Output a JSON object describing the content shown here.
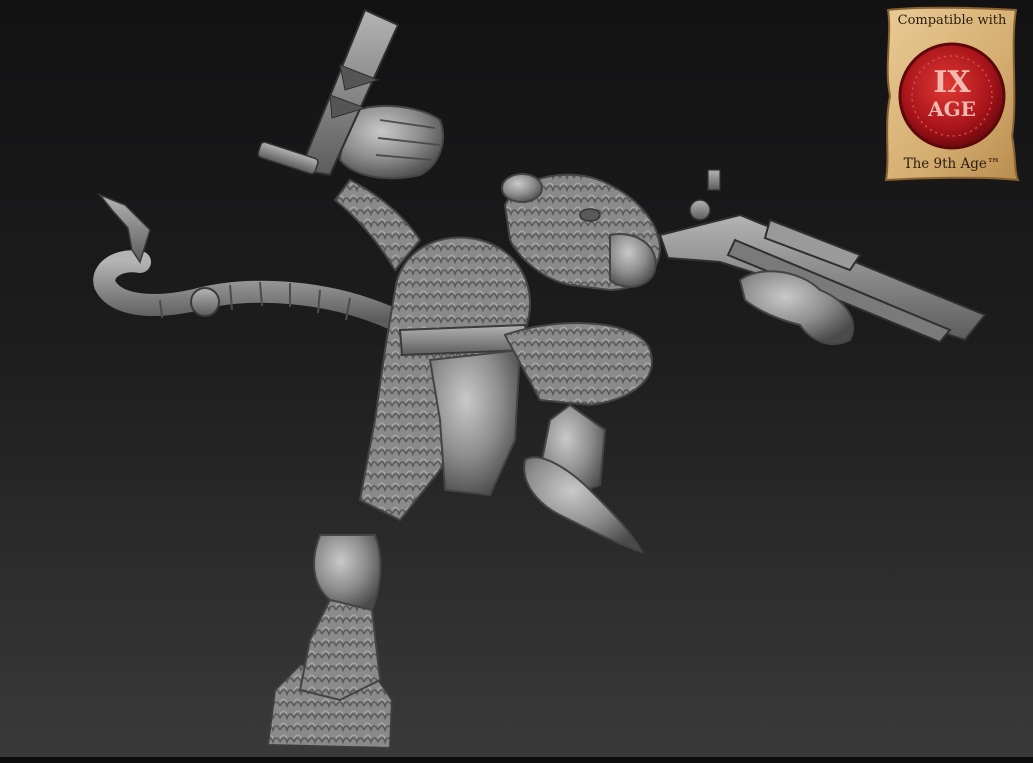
{
  "badge": {
    "top_text": "Compatible with",
    "bottom_text": "The 9th Age™",
    "seal_roman": "IX",
    "seal_word": "AGE"
  },
  "colors": {
    "background_top": "#121213",
    "background_bottom": "#3a3a3b",
    "model_gray": "#8e8e8e",
    "parchment": "#d9b57c",
    "seal_red": "#b3141a"
  }
}
